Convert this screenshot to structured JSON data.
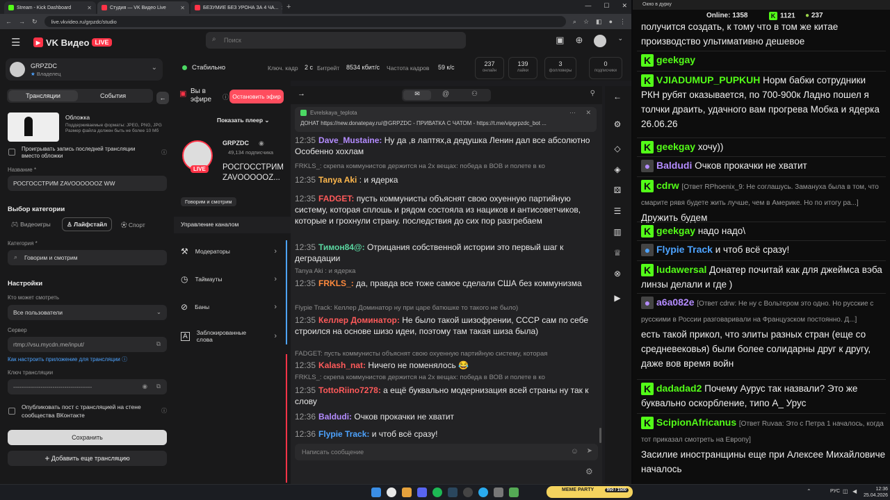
{
  "tabs": [
    {
      "title": "Stream - Kick Dashboard",
      "color": "#53fc18"
    },
    {
      "title": "Студия — VK Видео Live",
      "color": "#ff3347"
    },
    {
      "title": "БЕЗУМИЕ БЕЗ УРОНА ЗА 4 ЧА...",
      "color": "#ff3347"
    }
  ],
  "url": "live.vkvideo.ru/grpzdc/studio",
  "vk": {
    "brand": "VK Видео",
    "live_badge": "LIVE",
    "search_placeholder": "Поиск"
  },
  "channel": {
    "name": "GRPZDC",
    "role": "Владелец",
    "followers": "49,134 подписчика",
    "title_short": "РОСГОССТРИМ ZAVOOOOOZ..."
  },
  "status": {
    "state": "Стабильно",
    "keyframe_label": "Ключ. кадр",
    "keyframe": "2 с",
    "bitrate_label": "Битрейт",
    "bitrate": "8534 кбит/с",
    "fps_label": "Частота кадров",
    "fps": "59 к/с"
  },
  "stats": [
    {
      "v": "237",
      "l": "онлайн"
    },
    {
      "v": "139",
      "l": "лайки"
    },
    {
      "v": "3",
      "l": "фолловеры"
    },
    {
      "v": "0",
      "l": "подписчики"
    }
  ],
  "left": {
    "tab_streams": "Трансляции",
    "tab_events": "События",
    "cover_title": "Обложка",
    "cover_desc": "Поддерживаемые форматы: JPEG, PNG, JPG Размер файла должен быть не более 10 Мб",
    "replay_label": "Проигрывать запись последней трансляции вместо обложки",
    "name_label": "Название *",
    "name_value": "РОСГОССТРИМ ZAVOOOOOOZ WW",
    "category_choice": "Выбор категории",
    "cats": [
      "Видеоигры",
      "Лайфстайл",
      "Спорт"
    ],
    "category_label": "Категория *",
    "category_value": "Говорим и смотрим",
    "settings": "Настройки",
    "who_label": "Кто может смотреть",
    "who_value": "Все пользователи",
    "server_label": "Сервер",
    "server_value": "rtmp://vsu.mycdn.me/input/",
    "howto": "Как настроить приложение для трансляции",
    "key_label": "Ключ трансляции",
    "key_value": "----------------------------------------",
    "publish_label": "Опубликовать пост с трансляцией на стене сообщества ВКонтакте",
    "save": "Сохранить",
    "add": "Добавить еще трансляцию"
  },
  "mid": {
    "on_air": "Вы в эфире",
    "stop": "Остановить эфир",
    "show_player": "Показать плеер",
    "stream_title": "РОСГОССТРИМ ZAVOOOOOZ...",
    "tag": "Говорим и смотрим",
    "manage": "Управление каналом",
    "menu": [
      "Модераторы",
      "Таймауты",
      "Баны",
      "Заблокированные слова"
    ]
  },
  "pinned": {
    "author": "Evrelskaya_teplota",
    "text": "ДОНАТ https://new.donatepay.ru/@GRPZDC - ПРИВАТКА С ЧАТОМ - https://t.me/vipgrpzdc_bot ..."
  },
  "chat": [
    {
      "reply": "",
      "ts": "12:35",
      "user": "Dave_Mustaine:",
      "color": "#b48cff",
      "text": "Ну да ,в лаптях,а дедушка Ленин дал все абсолютно Особенно хохлам"
    },
    {
      "reply": "FRKLS_: скрепа коммунистов держится на 2х вещах: победа в ВОВ и полете в ко",
      "ts": "12:35",
      "user": "Tanya Aki",
      "color": "#ffb84d",
      "text": ": и ядерка"
    },
    {
      "reply": "",
      "ts": "12:35",
      "user": "FADGET:",
      "color": "#ff5a5a",
      "text": "пусть коммунисты объяснят свою охуенную партийную систему, которая сплошь и рядом состояла из нациков и антисоветчиков, которые и грохнули страну. последствия до сих пор разгребаем"
    },
    {
      "reply": "",
      "ts": "12:35",
      "user": "Тимон84@:",
      "color": "#5ad6a0",
      "text": "Отрицания собственной истории это первый шаг к деградации"
    },
    {
      "reply": "Tanya Aki : и ядерка",
      "ts": "12:35",
      "user": "FRKLS_:",
      "color": "#ff8a3d",
      "text": "да, правда все тоже самое сделали США без коммунизма"
    },
    {
      "reply": "Flypie Track: Келлер Доминатор ну при царе батюшке то такого не было)",
      "ts": "12:35",
      "user": "Келлер Доминатор:",
      "color": "#ff5a5a",
      "text": "Не было такой шизофрении, СССР сам по себе строился на основе шизо идеи, поэтому там такая шиза была)"
    },
    {
      "reply": "FADGET: пусть коммунисты объяснят свою охуенную партийную систему, которая",
      "ts": "12:35",
      "user": "Kalash_nat:",
      "color": "#ff5a5a",
      "text": "Ничего не поменялось 😂"
    },
    {
      "reply": "FRKLS_: скрепа коммунистов держится на 2х вещах: победа в ВОВ и полете в ко",
      "ts": "12:35",
      "user": "TottoRiino7278:",
      "color": "#ff5a5a",
      "text": "а ещё буквально модернизация всей страны ну так к слову"
    },
    {
      "reply": "",
      "ts": "12:36",
      "user": "Baldudi:",
      "color": "#b48cff",
      "text": "Очков прокачки не хватит"
    },
    {
      "reply": "",
      "ts": "12:36",
      "user": "Flypie Track:",
      "color": "#4da3ff",
      "text": "и чтоб всё сразу!"
    }
  ],
  "chat_placeholder": "Написать сообщение",
  "popup": {
    "title": "Окно в дурку",
    "online_label": "Online:",
    "online": "1358",
    "count1": "1121",
    "count2": "237",
    "messages": [
      {
        "user": "",
        "color": "#efefef",
        "reply": "",
        "text": "получится создать, к тому что в том же китае производство ультимативно дешевое"
      },
      {
        "user": "geekgay",
        "color": "#53fc18",
        "reply": "",
        "text": ""
      },
      {
        "user": "VJIADUMUP_PUPKUH",
        "color": "#53fc18",
        "reply": "",
        "text": "Норм бабки сотрудники РКН рубят оказывается, по 700-900к Ладно пошел я толчки драить, удачного вам прогрева Мобка и ядерка 26.06.26"
      },
      {
        "user": "geekgay",
        "color": "#53fc18",
        "reply": "",
        "text": "хочу))"
      },
      {
        "user": "Baldudi",
        "color": "#b48cff",
        "reply": "",
        "text": "Очков прокачки не хватит"
      },
      {
        "user": "cdrw",
        "color": "#53fc18",
        "reply": "[Ответ RPhoenix_9: Не соглашусь. Замануха была в том, что смарите рявя будете жить лучше, чем в Америке. Но по итогу ра...]",
        "text": "Дружить будем"
      },
      {
        "user": "geekgay",
        "color": "#53fc18",
        "reply": "",
        "text": "надо надо\\"
      },
      {
        "user": "Flypie Track",
        "color": "#4da3ff",
        "reply": "",
        "text": "и чтоб всё сразу!"
      },
      {
        "user": "ludawersal",
        "color": "#53fc18",
        "reply": "",
        "text": "Донатер почитай как для джеймса вэба линзы делали и где )"
      },
      {
        "user": "a6a082e",
        "color": "#b48cff",
        "reply": "[Ответ cdrw: Не ну с Вольтером это одно. Но русские с русскими в России разговаривали на Французском постоянно. Д...]",
        "text": "есть такой прикол, что элиты разных стран (еще со средневековья) были более солидарны друг к другу, даже вов время войн"
      },
      {
        "user": "dadadad2",
        "color": "#53fc18",
        "reply": "",
        "text": "Почему Аурус так назвали? Это же буквально оскорбление, типо А_ Урус"
      },
      {
        "user": "ScipionAfricanus",
        "color": "#53fc18",
        "reply": "[Ответ Ruvaa: Это с Петра 1 началось, когда тот приказал смотреть на Европу]",
        "text": "Засилие иностранщины еще при Алексее Михайловиче началось"
      }
    ]
  },
  "taskbar": {
    "lang": "РУС",
    "time": "12:36",
    "date": "25.04.2026",
    "widget": "MEME PARTY",
    "widget_val": "950 / 1500"
  }
}
